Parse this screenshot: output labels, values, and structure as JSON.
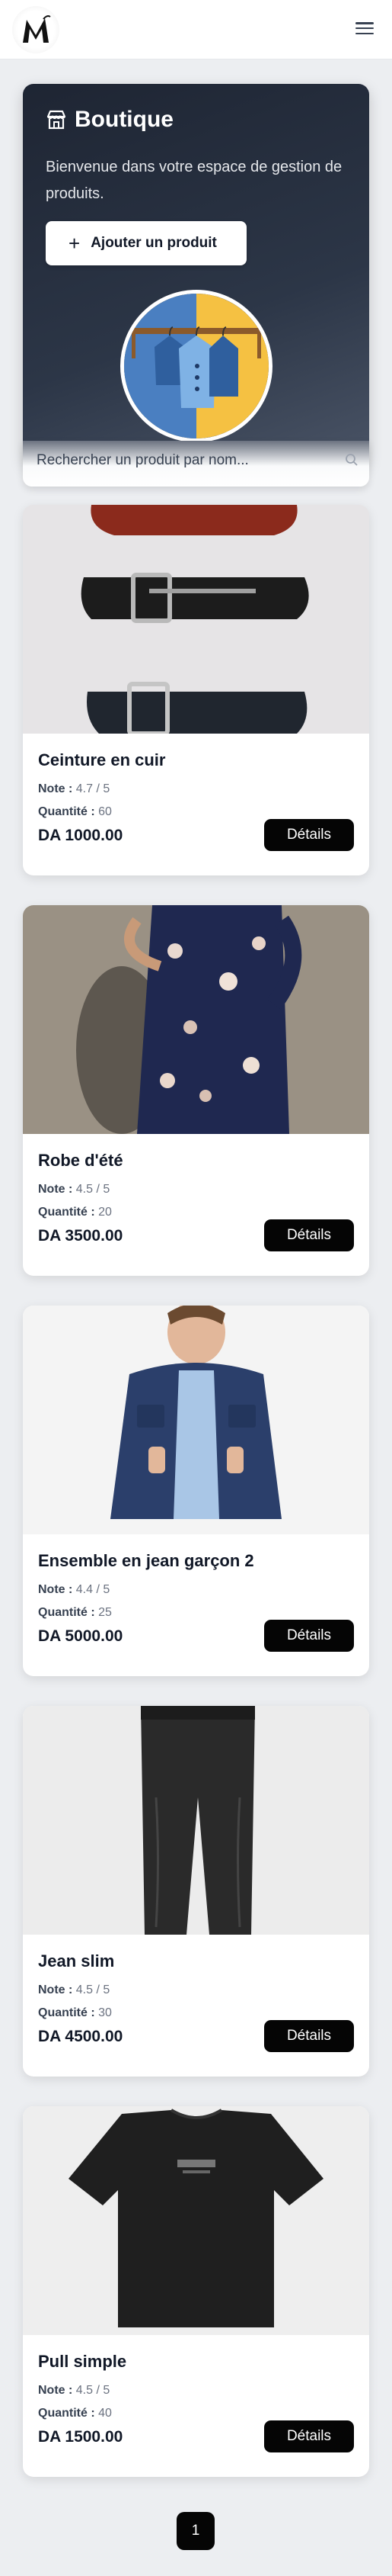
{
  "header": {
    "logo_icon": "brand-m-logo",
    "menu_icon": "hamburger-icon"
  },
  "hero": {
    "title": "Boutique",
    "description": "Bienvenue dans votre espace de gestion de produits.",
    "add_button_label": "Ajouter un produit",
    "store_icon": "store-icon",
    "illustration_icon": "clothes-rack-illustration"
  },
  "search": {
    "placeholder": "Rechercher un produit par nom..."
  },
  "labels": {
    "rating": "Note :",
    "quantity": "Quantité :",
    "details": "Détails"
  },
  "products": [
    {
      "name": "Ceinture en cuir",
      "rating": "4.7 / 5",
      "quantity": "60",
      "price": "DA 1000.00",
      "image": "leather-belts-photo"
    },
    {
      "name": "Robe d'été",
      "rating": "4.5 / 5",
      "quantity": "20",
      "price": "DA 3500.00",
      "image": "floral-summer-dress-photo"
    },
    {
      "name": "Ensemble en jean garçon 2",
      "rating": "4.4 / 5",
      "quantity": "25",
      "price": "DA 5000.00",
      "image": "boy-denim-jacket-photo"
    },
    {
      "name": "Jean slim",
      "rating": "4.5 / 5",
      "quantity": "30",
      "price": "DA 4500.00",
      "image": "black-slim-jeans-photo"
    },
    {
      "name": "Pull simple",
      "rating": "4.5 / 5",
      "quantity": "40",
      "price": "DA 1500.00",
      "image": "black-tshirt-photo"
    }
  ],
  "pagination": {
    "current_page": "1"
  },
  "colors": {
    "hero_dark": "#1e2533",
    "button_dark": "#050505",
    "page_bg": "#eceef1"
  }
}
